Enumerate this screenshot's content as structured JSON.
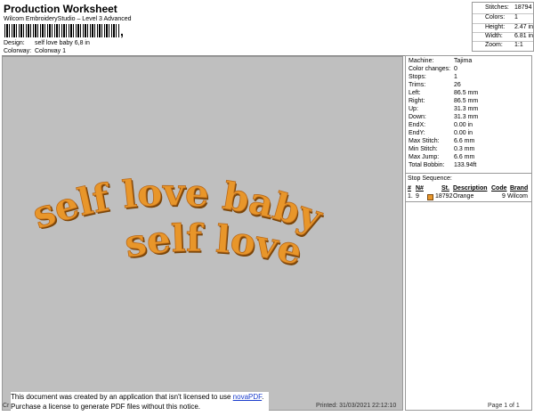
{
  "header": {
    "title": "Production Worksheet",
    "subtitle": "Wilcom EmbroideryStudio – Level 3 Advanced",
    "barcode_suffix": ",",
    "design_label": "Design:",
    "design_value": "self love baby 6,8 in",
    "colorway_label": "Colorway:",
    "colorway_value": "Colorway 1"
  },
  "stats": [
    {
      "label": "Stitches:",
      "value": "18794"
    },
    {
      "label": "Colors:",
      "value": "1"
    },
    {
      "label": "Height:",
      "value": "2.47 in"
    },
    {
      "label": "Width:",
      "value": "6.81 in"
    },
    {
      "label": "Zoom:",
      "value": "1:1"
    }
  ],
  "design_preview": {
    "line1": "self love baby",
    "line2": "self love",
    "thread_color": "#E8962A",
    "background": "#BFBFBF"
  },
  "machine_info": [
    {
      "label": "Machine:",
      "value": "Tajima"
    },
    {
      "label": "Color changes:",
      "value": "0"
    },
    {
      "label": "Stops:",
      "value": "1"
    },
    {
      "label": "Trims:",
      "value": "26"
    },
    {
      "label": "Left:",
      "value": "86.5 mm"
    },
    {
      "label": "Right:",
      "value": "86.5 mm"
    },
    {
      "label": "Up:",
      "value": "31.3 mm"
    },
    {
      "label": "Down:",
      "value": "31.3 mm"
    },
    {
      "label": "EndX:",
      "value": "0.00 in"
    },
    {
      "label": "EndY:",
      "value": "0.00 in"
    },
    {
      "label": "Max Stitch:",
      "value": "6.6 mm"
    },
    {
      "label": "Min Stitch:",
      "value": "0.3 mm"
    },
    {
      "label": "Max Jump:",
      "value": "6.6 mm"
    },
    {
      "label": "Total Bobbin:",
      "value": "133.94ft"
    }
  ],
  "stop_sequence": {
    "heading": "Stop Sequence:",
    "columns": {
      "num": "#",
      "n": "N#",
      "st": "St.",
      "description": "Description",
      "code": "Code",
      "brand": "Brand"
    },
    "rows": [
      {
        "num": "1.",
        "n": "9",
        "st": "18792",
        "description": "Orange",
        "code": "9",
        "brand": "Wilcom",
        "color": "#E8962A"
      }
    ]
  },
  "notice": {
    "line1_text": "This document was created by an application that isn't licensed to use ",
    "line1_link": "novaPDF",
    "line1_end": ".",
    "line2": "Purchase a license to generate PDF files without this notice."
  },
  "footer": {
    "left": "Cr",
    "printed": "Printed: 31/03/2021 22:12:10",
    "page": "Page 1 of 1"
  }
}
